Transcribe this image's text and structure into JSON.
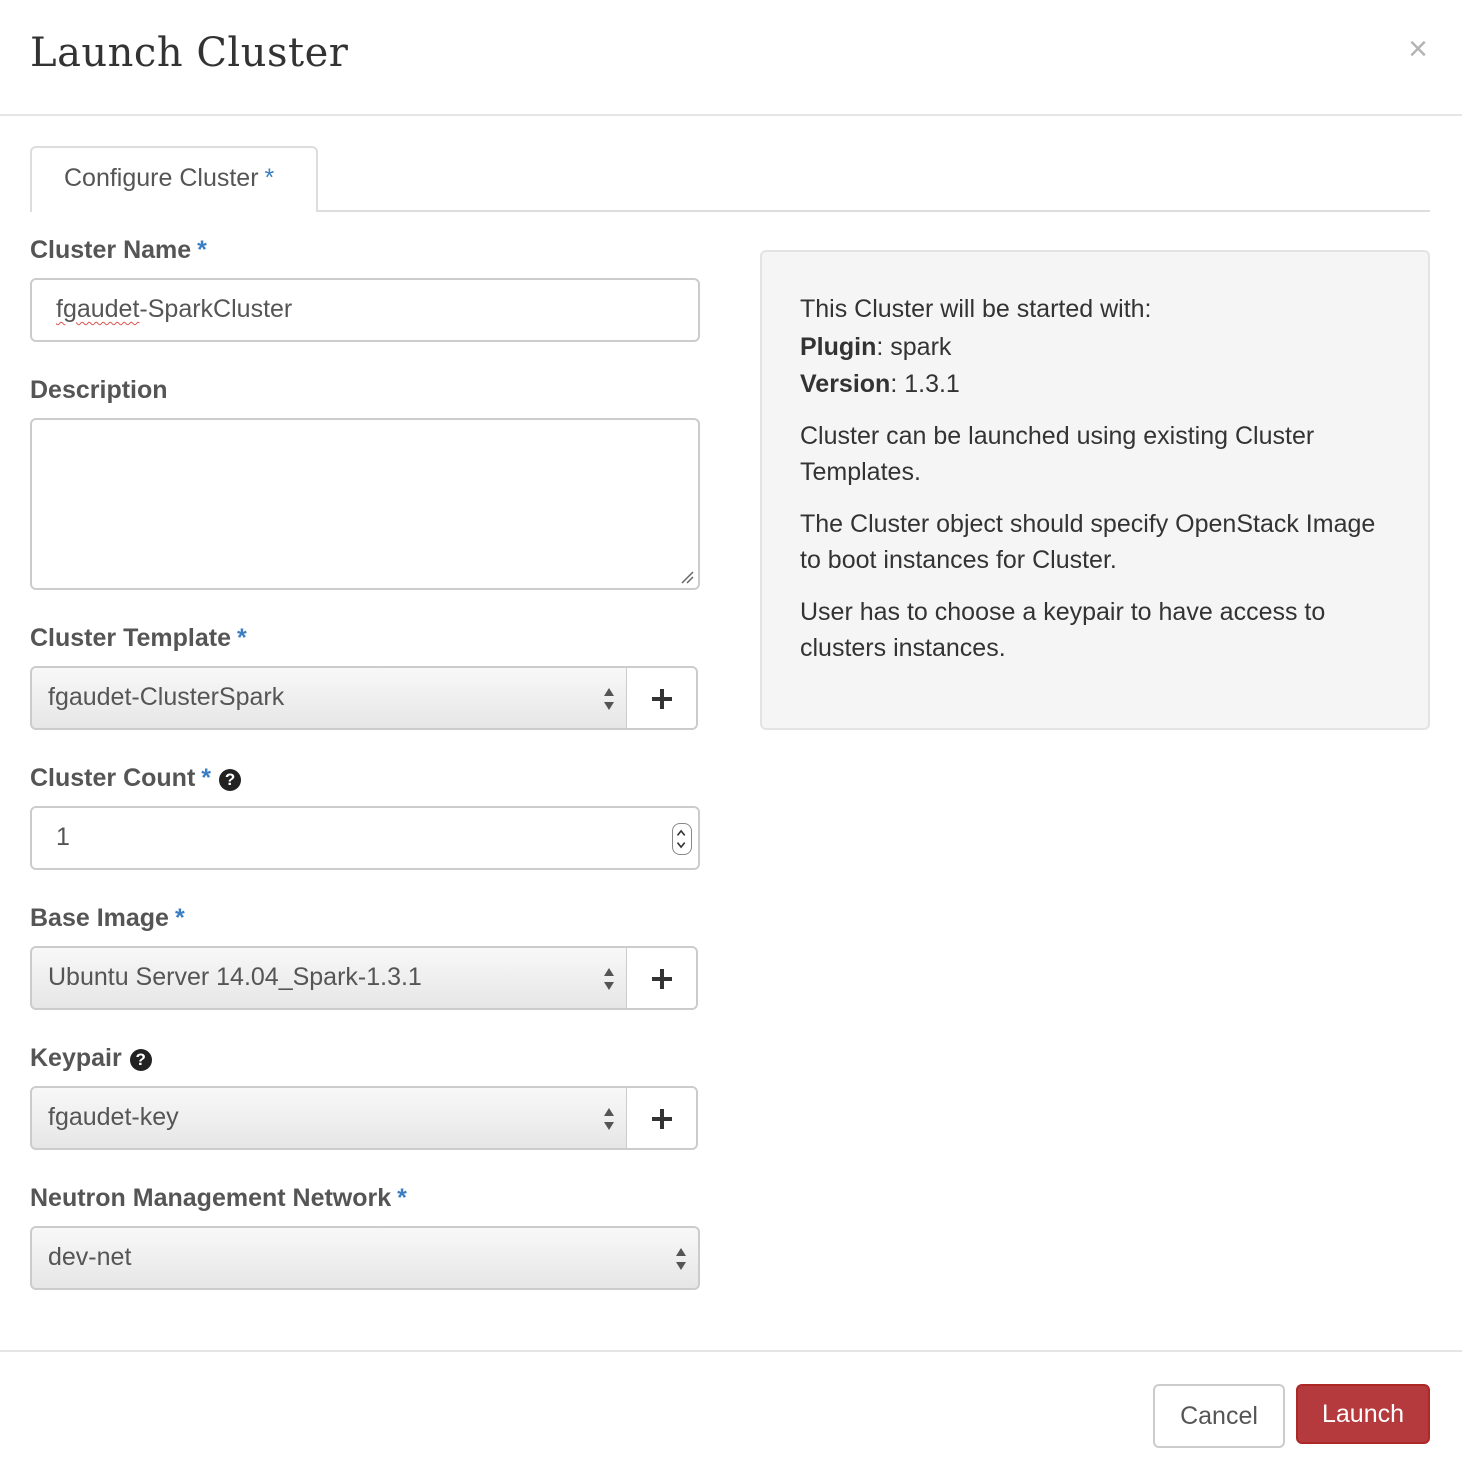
{
  "modal": {
    "title": "Launch Cluster",
    "close_glyph": "×"
  },
  "tabs": [
    {
      "label": "Configure Cluster",
      "required_mark": "*"
    }
  ],
  "form": {
    "cluster_name": {
      "label": "Cluster Name",
      "required_mark": "*",
      "value_misspelled": "fgaudet",
      "value_rest": "-SparkCluster"
    },
    "description": {
      "label": "Description",
      "value": ""
    },
    "cluster_template": {
      "label": "Cluster Template",
      "required_mark": "*",
      "selected": "fgaudet-ClusterSpark",
      "add_glyph": "+"
    },
    "cluster_count": {
      "label": "Cluster Count",
      "required_mark": "*",
      "help_glyph": "?",
      "value": "1"
    },
    "base_image": {
      "label": "Base Image",
      "required_mark": "*",
      "selected": "Ubuntu Server 14.04_Spark-1.3.1",
      "add_glyph": "+"
    },
    "keypair": {
      "label": "Keypair",
      "help_glyph": "?",
      "selected": "fgaudet-key",
      "add_glyph": "+"
    },
    "neutron_network": {
      "label": "Neutron Management Network",
      "required_mark": "*",
      "selected": "dev-net"
    }
  },
  "info_panel": {
    "intro": "This Cluster will be started with:",
    "plugin_label": "Plugin",
    "plugin_value": ": spark",
    "version_label": "Version",
    "version_value": ": 1.3.1",
    "para1": "Cluster can be launched using existing Cluster Templates.",
    "para2": "The Cluster object should specify OpenStack Image to boot instances for Cluster.",
    "para3": "User has to choose a keypair to have access to clusters instances."
  },
  "footer": {
    "cancel_label": "Cancel",
    "launch_label": "Launch"
  },
  "colors": {
    "required_mark": "#3a7fc4",
    "launch_button": "#b43a3e",
    "info_panel_bg": "#f5f5f5"
  },
  "icons": [
    "close-icon",
    "plus-icon",
    "help-icon",
    "select-arrows-icon",
    "number-stepper-icon",
    "resize-grip-icon"
  ]
}
